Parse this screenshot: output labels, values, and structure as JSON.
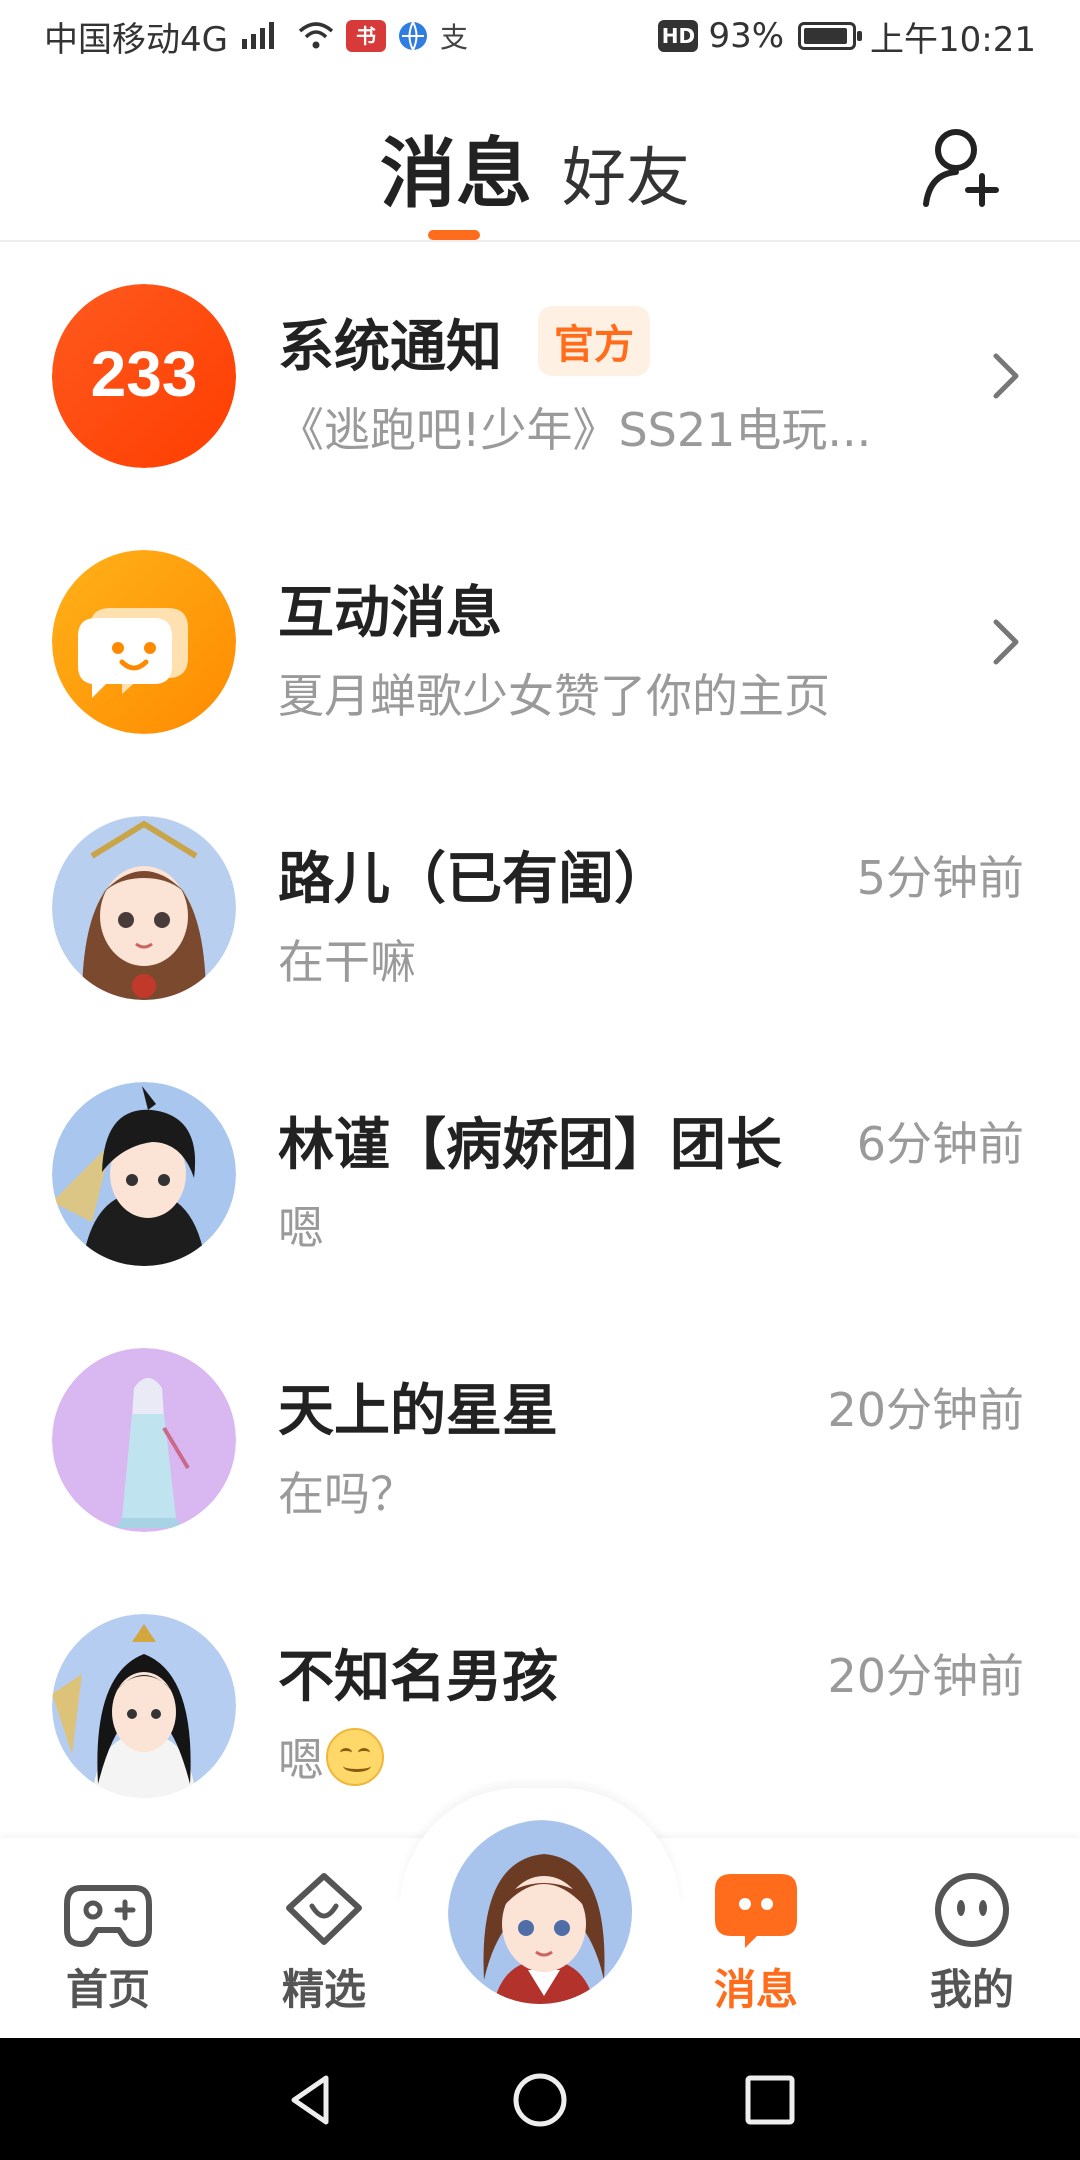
{
  "status_bar": {
    "carrier": "中国移动4G",
    "network": "4G",
    "app_icon_1": "书",
    "app_icon_3": "支",
    "hd": "HD",
    "battery": "93%",
    "battery_level": 0.93,
    "time": "上午10:21"
  },
  "header": {
    "tab_active": "消息",
    "tab_friends": "好友"
  },
  "messages": [
    {
      "name": "系统通知",
      "badge": "官方",
      "preview": "《逃跑吧!少年》SS21电玩...",
      "avatar": "233",
      "time": ""
    },
    {
      "name": "互动消息",
      "preview": "夏月蝉歌少女赞了你的主页",
      "avatar": "chat-bubble",
      "time": ""
    },
    {
      "name": "路儿（已有闺）",
      "preview": "在干嘛",
      "time": "5分钟前"
    },
    {
      "name": "林谨【病娇团】团长",
      "preview": "嗯",
      "time": "6分钟前"
    },
    {
      "name": "天上的星星",
      "preview": "在吗？",
      "time": "20分钟前"
    },
    {
      "name": "不知名男孩",
      "preview": "嗯",
      "time": "20分钟前"
    }
  ],
  "bottom_nav": {
    "home": "首页",
    "featured": "精选",
    "messages": "消息",
    "mine": "我的"
  },
  "colors": {
    "accent": "#ff6d1c",
    "muted_text": "#9a9a9a"
  },
  "icons": {
    "add_friend": "add-friend-icon",
    "chevron": "chevron-right-icon",
    "home": "gamepad-icon",
    "featured": "heart-badge-icon",
    "messages": "chat-icon",
    "mine": "face-icon"
  }
}
